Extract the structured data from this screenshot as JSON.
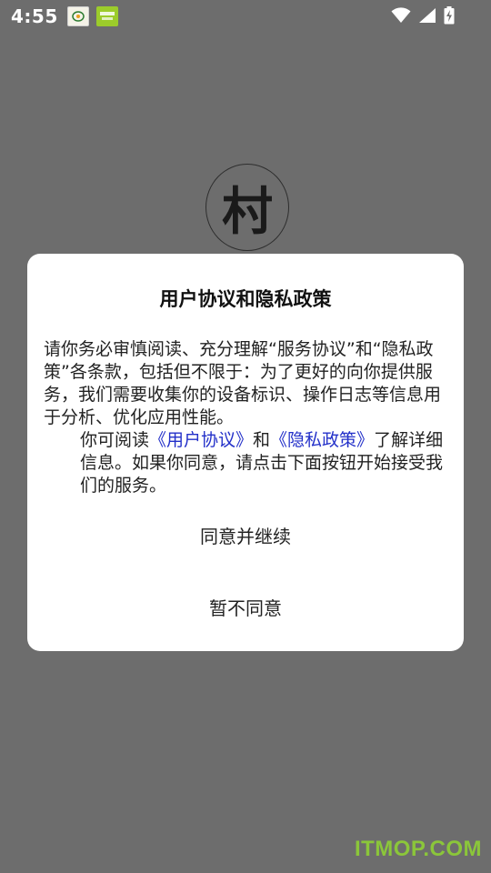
{
  "status_bar": {
    "time": "4:55",
    "icons": [
      "wifi-icon",
      "signal-icon",
      "battery-charging-icon"
    ],
    "notification_icons": [
      "app-notification-icon",
      "app-notification-icon"
    ]
  },
  "app": {
    "logo_char": "村"
  },
  "dialog": {
    "title": "用户协议和隐私政策",
    "paragraph1": "请你务必审慎阅读、充分理解“服务协议”和“隐私政策”各条款，包括但不限于：为了更好的向你提供服务，我们需要收集你的设备标识、操作日志等信息用于分析、优化应用性能。",
    "p2_prefix": "你可阅读",
    "user_agreement_link": "《用户协议》",
    "p2_and": "和",
    "privacy_policy_link": "《隐私政策》",
    "p2_suffix": "了解详细信息。如果你同意，请点击下面按钮开始接受我们的服务。",
    "agree_button": "同意并继续",
    "decline_button": "暂不同意"
  },
  "watermark": "ITMOP.COM",
  "colors": {
    "overlay": "#6d6d6d",
    "link": "#2330c9",
    "watermark": "#8bc63a"
  }
}
